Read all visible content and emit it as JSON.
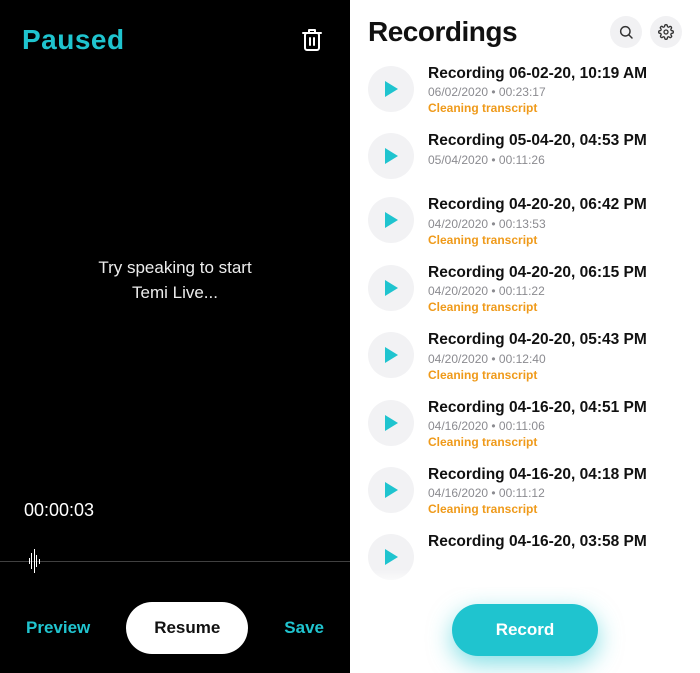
{
  "left": {
    "status_title": "Paused",
    "prompt_line1": "Try speaking to start",
    "prompt_line2": "Temi Live...",
    "elapsed": "00:00:03",
    "preview_label": "Preview",
    "resume_label": "Resume",
    "save_label": "Save"
  },
  "right": {
    "title": "Recordings",
    "record_label": "Record",
    "items": [
      {
        "title": "Recording 06-02-20, 10:19 AM",
        "meta": "06/02/2020 • 00:23:17",
        "status": "Cleaning transcript"
      },
      {
        "title": "Recording 05-04-20, 04:53 PM",
        "meta": "05/04/2020 • 00:11:26",
        "status": ""
      },
      {
        "title": "Recording 04-20-20, 06:42 PM",
        "meta": "04/20/2020 • 00:13:53",
        "status": "Cleaning transcript"
      },
      {
        "title": "Recording 04-20-20, 06:15 PM",
        "meta": "04/20/2020 • 00:11:22",
        "status": "Cleaning transcript"
      },
      {
        "title": "Recording 04-20-20, 05:43 PM",
        "meta": "04/20/2020 • 00:12:40",
        "status": "Cleaning transcript"
      },
      {
        "title": "Recording 04-16-20, 04:51 PM",
        "meta": "04/16/2020 • 00:11:06",
        "status": "Cleaning transcript"
      },
      {
        "title": "Recording 04-16-20, 04:18 PM",
        "meta": "04/16/2020 • 00:11:12",
        "status": "Cleaning transcript"
      },
      {
        "title": "Recording 04-16-20, 03:58 PM",
        "meta": "",
        "status": ""
      }
    ]
  }
}
